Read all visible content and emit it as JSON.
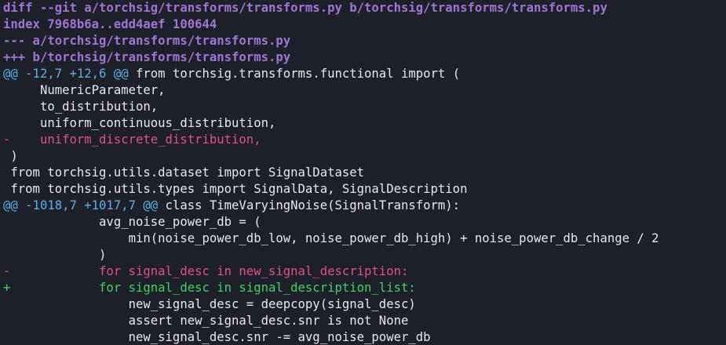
{
  "colors": {
    "background": "#1e2029",
    "meta": "#9d76d4",
    "hunk": "#5aaee6",
    "context": "#e8e8ec",
    "deleted": "#e0508a",
    "added": "#3ed16a"
  },
  "diff": {
    "header_git": "diff --git a/torchsig/transforms/transforms.py b/torchsig/transforms/transforms.py",
    "header_index": "index 7968b6a..edd4aef 100644",
    "header_old": "--- a/torchsig/transforms/transforms.py",
    "header_new": "+++ b/torchsig/transforms/transforms.py",
    "hunk1_range": "@@ -12,7 +12,6 @@",
    "hunk1_context": " from torchsig.transforms.functional import (",
    "lines1": [
      "     NumericParameter,",
      "     to_distribution,",
      "     uniform_continuous_distribution,",
      "-    uniform_discrete_distribution,",
      " )",
      " from torchsig.utils.dataset import SignalDataset",
      " from torchsig.utils.types import SignalData, SignalDescription"
    ],
    "hunk2_range": "@@ -1018,7 +1017,7 @@",
    "hunk2_context": " class TimeVaryingNoise(SignalTransform):",
    "lines2": [
      "             avg_noise_power_db = (",
      "                 min(noise_power_db_low, noise_power_db_high) + noise_power_db_change / 2",
      "             )",
      "-            for signal_desc in new_signal_description:",
      "+            for signal_desc in signal_description_list:",
      "                 new_signal_desc = deepcopy(signal_desc)",
      "                 assert new_signal_desc.snr is not None",
      "                 new_signal_desc.snr -= avg_noise_power_db"
    ]
  }
}
